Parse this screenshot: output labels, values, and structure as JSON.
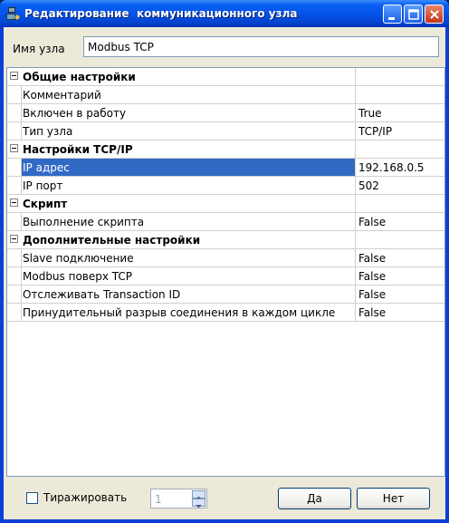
{
  "window": {
    "title": "Редактирование  коммуникационного узла",
    "colors": {
      "titlebar": "#0553e8",
      "selection": "#316ac5",
      "face": "#ece9d8"
    }
  },
  "node": {
    "label": "Имя узла",
    "value": "Modbus TCP"
  },
  "grid": {
    "sections": [
      {
        "title": "Общие настройки",
        "rows": [
          {
            "name": "Комментарий",
            "value": ""
          },
          {
            "name": "Включен в работу",
            "value": "True"
          },
          {
            "name": "Тип узла",
            "value": "TCP/IP"
          }
        ]
      },
      {
        "title": "Настройки TCP/IP",
        "rows": [
          {
            "name": "IP адрес",
            "value": "192.168.0.5"
          },
          {
            "name": "IP порт",
            "value": "502"
          }
        ]
      },
      {
        "title": "Скрипт",
        "rows": [
          {
            "name": "Выполнение скрипта",
            "value": "False"
          }
        ]
      },
      {
        "title": "Дополнительные настройки",
        "rows": [
          {
            "name": "Slave подключение",
            "value": "False"
          },
          {
            "name": "Modbus поверх TCP",
            "value": "False"
          },
          {
            "name": "Отслеживать Transaction ID",
            "value": "False"
          },
          {
            "name": "Принудительный разрыв соединения в каждом цикле",
            "value": "False"
          }
        ]
      }
    ],
    "selected": "IP адрес"
  },
  "bottom": {
    "replicate_label": "Тиражировать",
    "replicate_checked": false,
    "count_value": "1",
    "ok_label": "Да",
    "cancel_label": "Нет"
  }
}
